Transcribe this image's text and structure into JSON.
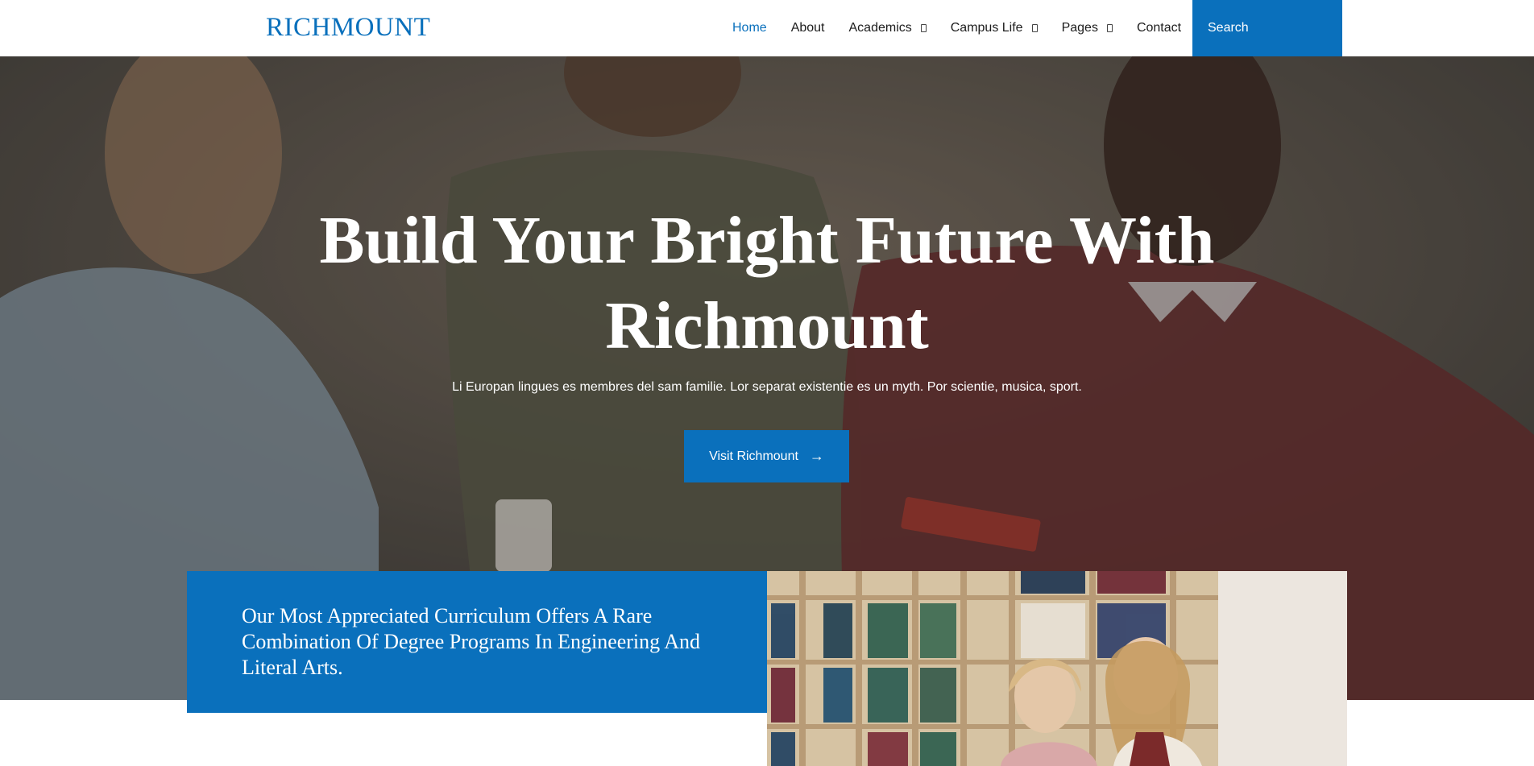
{
  "header": {
    "logo": "RICHMOUNT",
    "nav": [
      {
        "label": "Home",
        "active": true,
        "has_dropdown": false
      },
      {
        "label": "About",
        "active": false,
        "has_dropdown": false
      },
      {
        "label": "Academics",
        "active": false,
        "has_dropdown": true
      },
      {
        "label": "Campus Life",
        "active": false,
        "has_dropdown": true
      },
      {
        "label": "Pages",
        "active": false,
        "has_dropdown": true
      },
      {
        "label": "Contact",
        "active": false,
        "has_dropdown": false
      }
    ],
    "search_label": "Search"
  },
  "hero": {
    "title_line1": "Build Your Bright Future With",
    "title_line2": "Richmount",
    "subtitle": "Li Europan lingues es membres del sam familie. Lor separat existentie es un myth. Por scientie, musica, sport.",
    "cta_label": "Visit Richmount",
    "cta_icon": "arrow-right-icon"
  },
  "feature": {
    "text": "Our Most Appreciated Curriculum Offers A Rare Combination Of Degree Programs In Engineering And Literal Arts."
  },
  "colors": {
    "accent": "#0a70bc",
    "white": "#ffffff"
  }
}
